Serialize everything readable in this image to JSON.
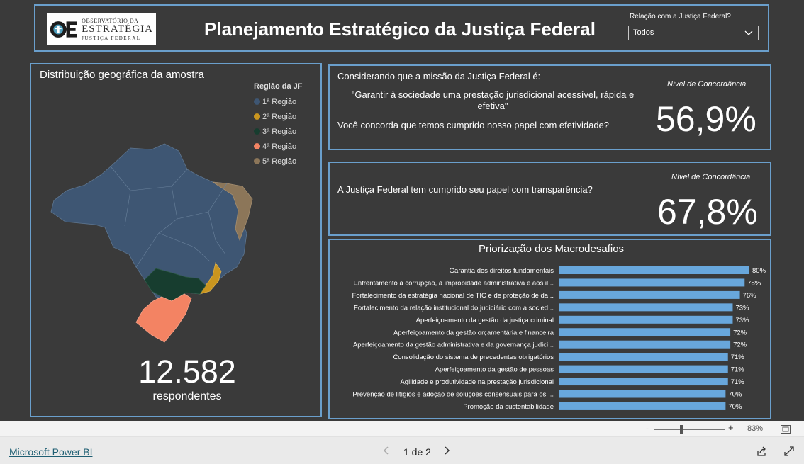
{
  "header": {
    "logo": {
      "line1": "OBSERVATÓRIO DA",
      "line2": "ESTRATÉGIA",
      "line3": "JUSTIÇA FEDERAL"
    },
    "title": "Planejamento Estratégico da Justiça Federal",
    "filter_label": "Relação com a Justiça Federal?",
    "filter_value": "Todos"
  },
  "map": {
    "title": "Distribuição geográfica da amostra",
    "legend_title": "Região da JF",
    "legend": [
      {
        "label": "1ª Região",
        "color": "#3e5673"
      },
      {
        "label": "2ª Região",
        "color": "#c9951f"
      },
      {
        "label": "3ª Região",
        "color": "#173d2f"
      },
      {
        "label": "4ª Região",
        "color": "#f38363"
      },
      {
        "label": "5ª Região",
        "color": "#8c7659"
      }
    ],
    "respondents_value": "12.582",
    "respondents_label": "respondentes"
  },
  "kpi_missao": {
    "intro": "Considerando que a missão da Justiça Federal é:",
    "quote": "\"Garantir à sociedade uma prestação jurisdicional acessível, rápida e efetiva\"",
    "question": "Você concorda que temos cumprido nosso papel com efetividade?",
    "label": "Nível de Concordância",
    "value": "56,9%"
  },
  "kpi_transparencia": {
    "question": "A Justiça Federal tem cumprido seu papel com transparência?",
    "label": "Nível de Concordância",
    "value": "67,8%"
  },
  "chart_data": {
    "type": "bar",
    "title": "Priorização dos Macrodesafios",
    "categories": [
      "Garantia dos direitos fundamentais",
      "Enfrentamento à corrupção, à improbidade administrativa e aos il...",
      "Fortalecimento da estratégia nacional de TIC e de proteção de da...",
      "Fortalecimento da relação institucional do judiciário com a socied...",
      "Aperfeiçoamento da gestão da justiça criminal",
      "Aperfeiçoamento da gestão orçamentária e financeira",
      "Aperfeiçoamento da gestão administrativa e da governança judici...",
      "Consolidação do sistema de precedentes obrigatórios",
      "Aperfeiçoamento da gestão de pessoas",
      "Agilidade e produtividade na prestação jurisdicional",
      "Prevenção de litígios e adoção de soluções consensuais para os ...",
      "Promoção da sustentabilidade"
    ],
    "values": [
      80,
      78,
      76,
      73,
      73,
      72,
      72,
      71,
      71,
      71,
      70,
      70
    ],
    "value_labels": [
      "80%",
      "78%",
      "76%",
      "73%",
      "73%",
      "72%",
      "72%",
      "71%",
      "71%",
      "71%",
      "70%",
      "70%"
    ],
    "orientation": "horizontal",
    "bar_color": "#68a7dc",
    "xlim": [
      0,
      80
    ]
  },
  "statusbar": {
    "zoom_minus": "-",
    "zoom_plus": "+",
    "zoom_value": "83%",
    "zoom_level": 0.83
  },
  "footer": {
    "powerbi_link": "Microsoft Power BI",
    "page_indicator": "1 de 2"
  }
}
